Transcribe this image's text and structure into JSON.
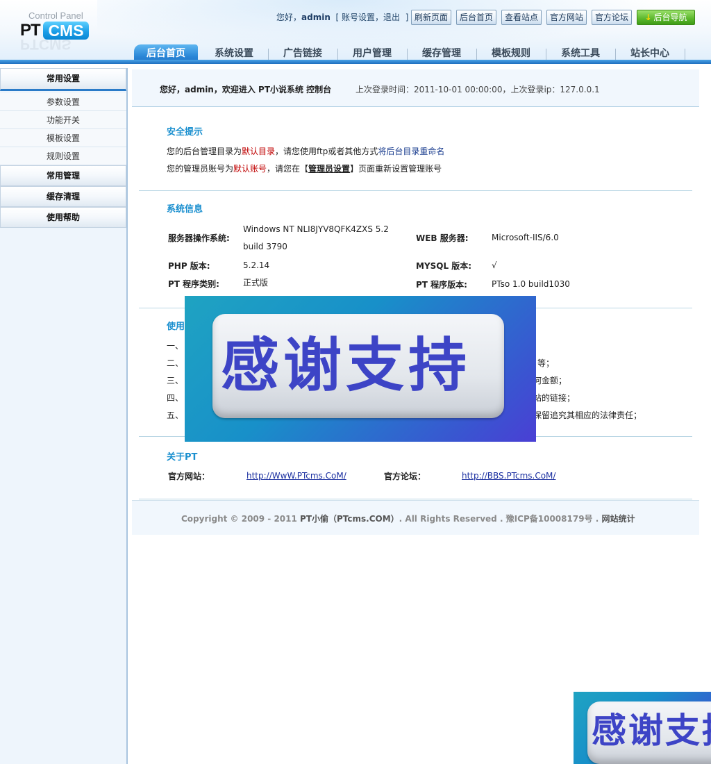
{
  "header": {
    "logo": {
      "control_panel": "Control Panel",
      "pt": "PT",
      "cms": "CMS"
    },
    "greeting": "您好，",
    "user": "admin",
    "account_settings": "账号设置",
    "logout": "退出",
    "buttons": [
      "刷新页面",
      "后台首页",
      "查看站点",
      "官方网站",
      "官方论坛"
    ],
    "nav_button": "后台导航"
  },
  "tabs": [
    "后台首页",
    "系统设置",
    "广告链接",
    "用户管理",
    "缓存管理",
    "模板规则",
    "系统工具",
    "站长中心"
  ],
  "sidebar": {
    "sections": [
      "常用设置",
      "常用管理",
      "缓存清理",
      "使用帮助"
    ],
    "items": [
      "参数设置",
      "功能开关",
      "模板设置",
      "规则设置"
    ]
  },
  "welcome": {
    "line": "您好，admin，欢迎进入  PT小说系统  控制台",
    "last_login": "上次登录时间：2011-10-01 00:00:00，上次登录ip：127.0.0.1"
  },
  "security": {
    "title": "安全提示",
    "l1a": "您的后台管理目录为",
    "l1b": "默认目录",
    "l1c": "，请您使用ftp或者其他方式",
    "l1d": "将后台目录重命名",
    "l2a": "您的管理员账号为",
    "l2b": "默认账号",
    "l2c": "，请您在【",
    "l2d": "管理员设置",
    "l2e": "】页面重新设置管理账号"
  },
  "sysinfo": {
    "title": "系统信息",
    "os_label": "服务器操作系统:",
    "os_value": "Windows NT NLI8JYV8QFK4ZXS 5.2 build 3790",
    "web_label": "WEB 服务器:",
    "web_value": "Microsoft-IIS/6.0",
    "php_label": "PHP 版本:",
    "php_value": "5.2.14",
    "mysql_label": "MYSQL 版本:",
    "mysql_value": "√",
    "type_label": "PT 程序类别:",
    "type_value": "正式版",
    "ver_label": "PT 程序版本:",
    "ver_value": "PTso 1.0 build1030"
  },
  "usage": {
    "title_partial": "使用",
    "items": [
      "一、",
      "二、",
      "三、",
      "四、",
      "五、"
    ],
    "tails": [
      "",
      "等；",
      "何金额；",
      "站的链接；",
      "保留追究其相应的法律责任；"
    ]
  },
  "about": {
    "title": "关于PT",
    "site_label": "官方网站：",
    "site_link": "http://WwW.PTcms.CoM/",
    "forum_label": "官方论坛：",
    "forum_link": "http://BBS.PTcms.CoM/"
  },
  "footer": {
    "copyright": "Copyright © 2009 - 2011 ",
    "brand": "PT小偷（PTcms.COM）",
    "rights": ". All Rights Reserved . 豫ICP备10008179号  .",
    "stats": "网站统计"
  },
  "ad": {
    "text": "感谢支持",
    "text_partial": "感谢支持"
  }
}
